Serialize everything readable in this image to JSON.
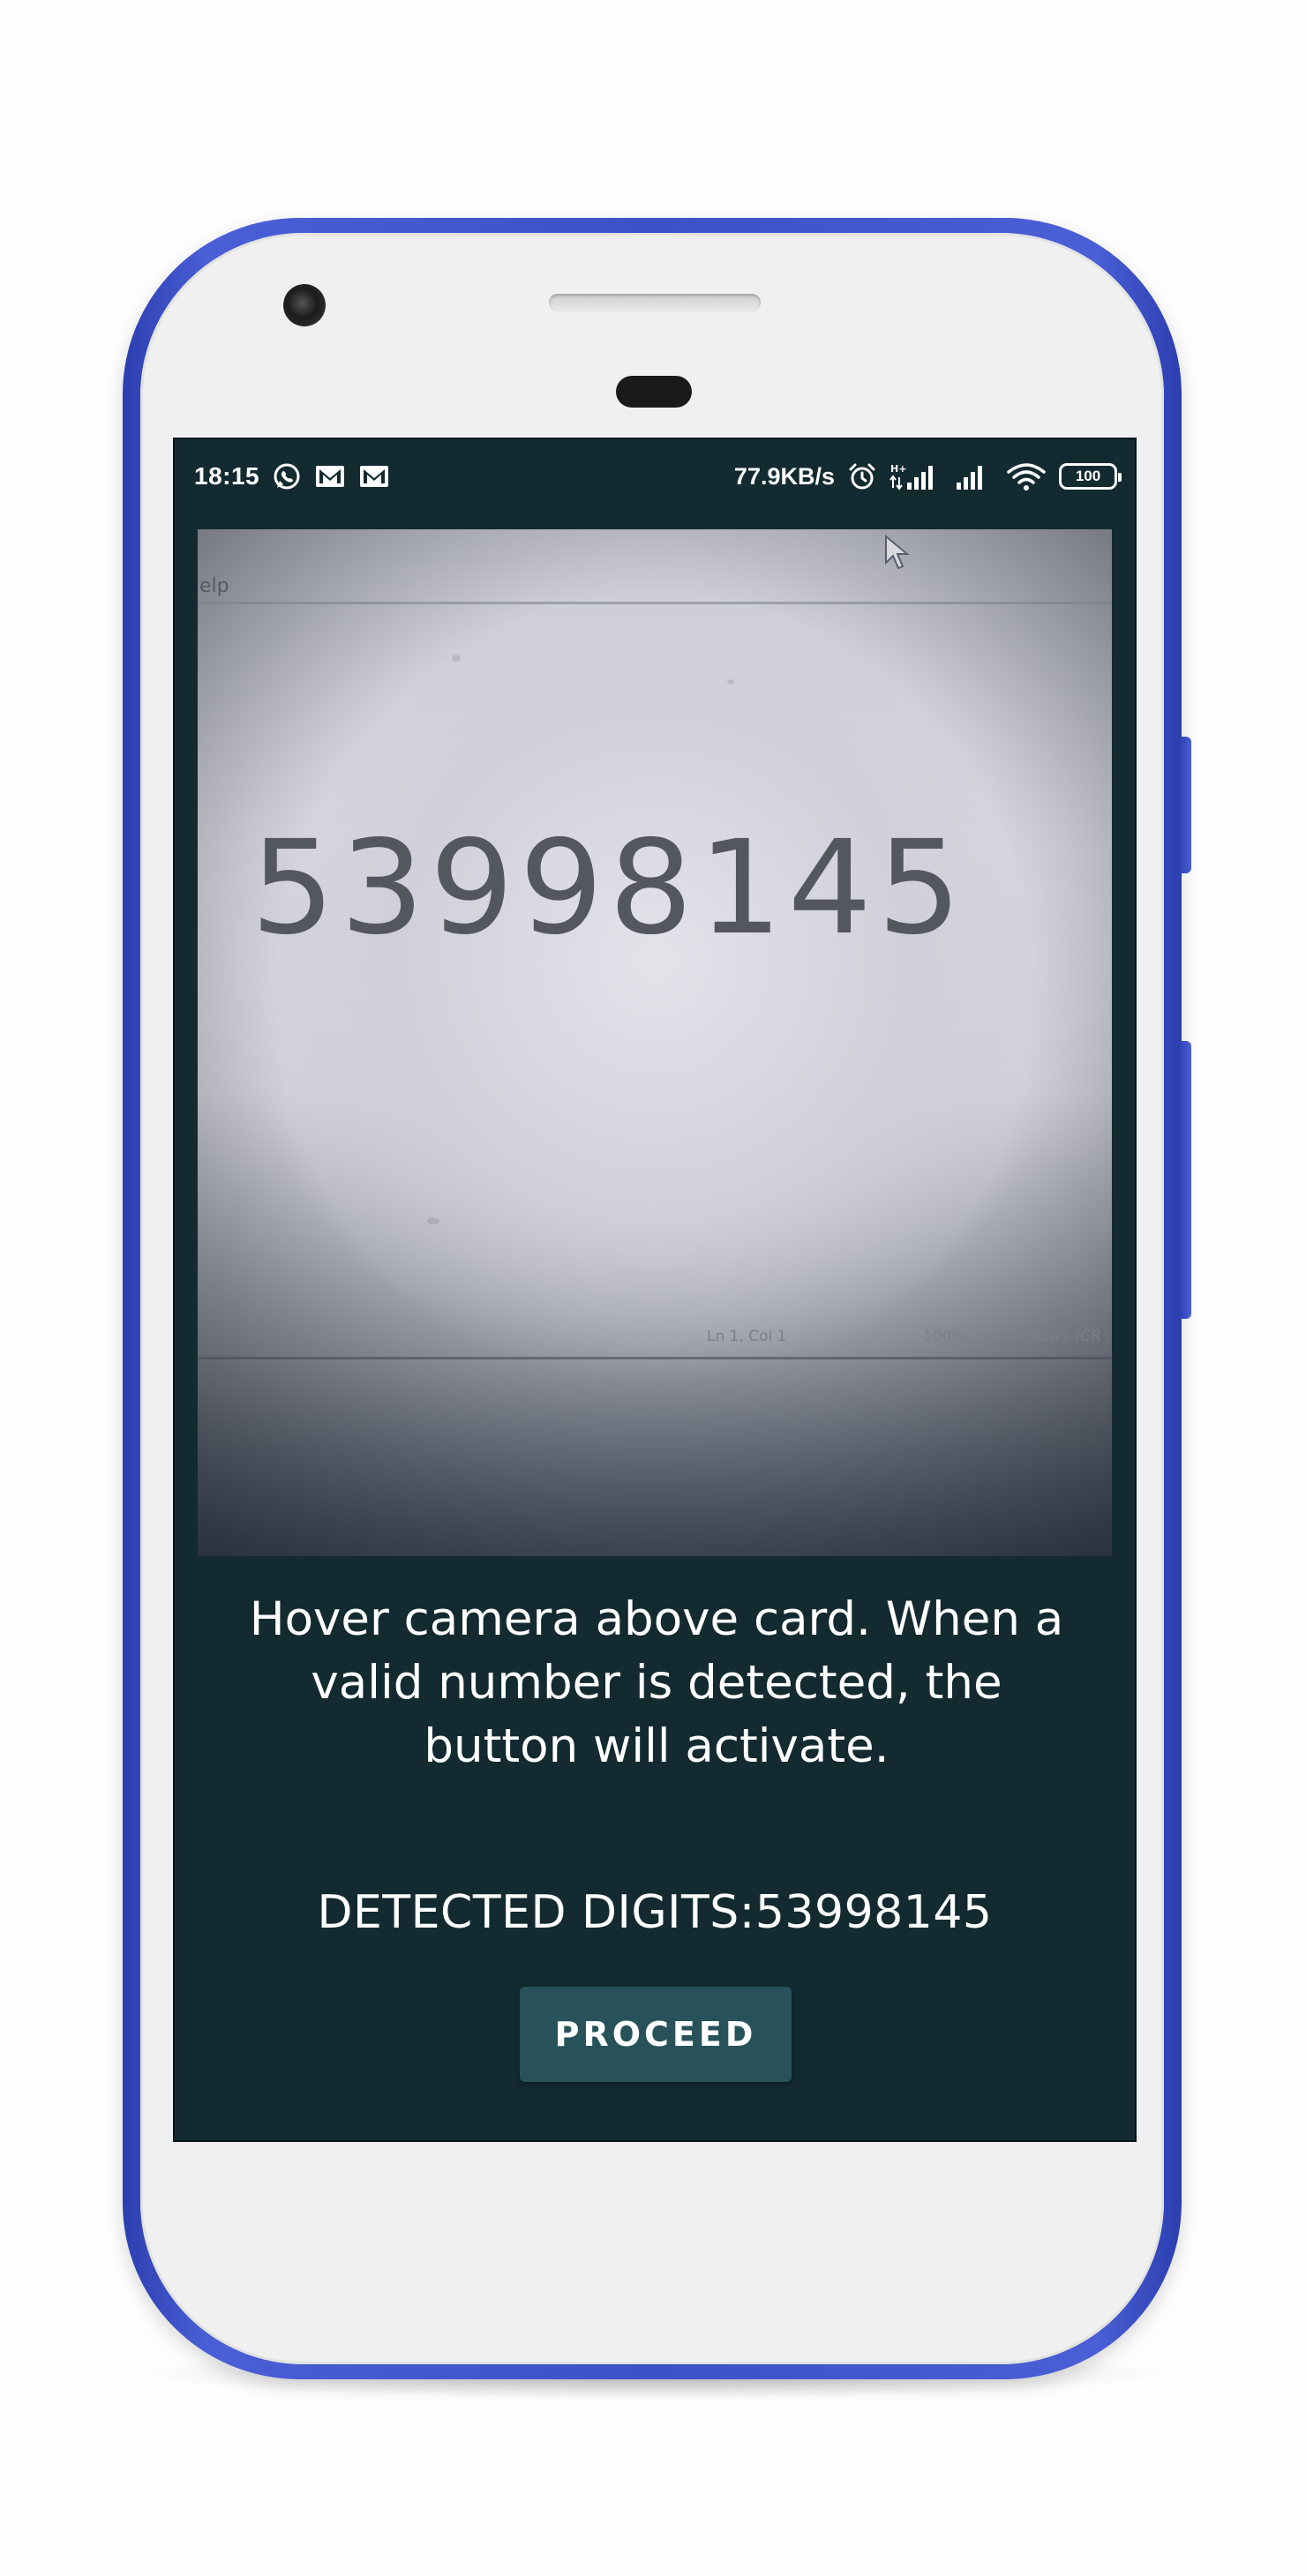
{
  "status_bar": {
    "time": "18:15",
    "network_speed": "77.9KB/s",
    "battery_level": "100",
    "notification_icons": [
      "whatsapp-icon",
      "gmail-icon",
      "gmail-icon"
    ],
    "system_icons": [
      "alarm-icon",
      "mobile-data-icon",
      "signal-icon",
      "signal-icon",
      "wifi-icon",
      "battery-icon"
    ],
    "data_type": "H+"
  },
  "camera_preview": {
    "captured_number": "53998145",
    "window_fragment": "elp",
    "status_position": "Ln 1, Col 1",
    "status_zoom": "100%",
    "status_encoding": "Windows (CR"
  },
  "main": {
    "instructions": "Hover camera above card. When a valid number is detected, the button will activate.",
    "detected_label": "DETECTED DIGITS:",
    "detected_value": "53998145",
    "proceed_label": "PROCEED"
  },
  "colors": {
    "screen_background": "#132a31",
    "button_background": "#275259",
    "phone_frame": "#3c50c8"
  }
}
